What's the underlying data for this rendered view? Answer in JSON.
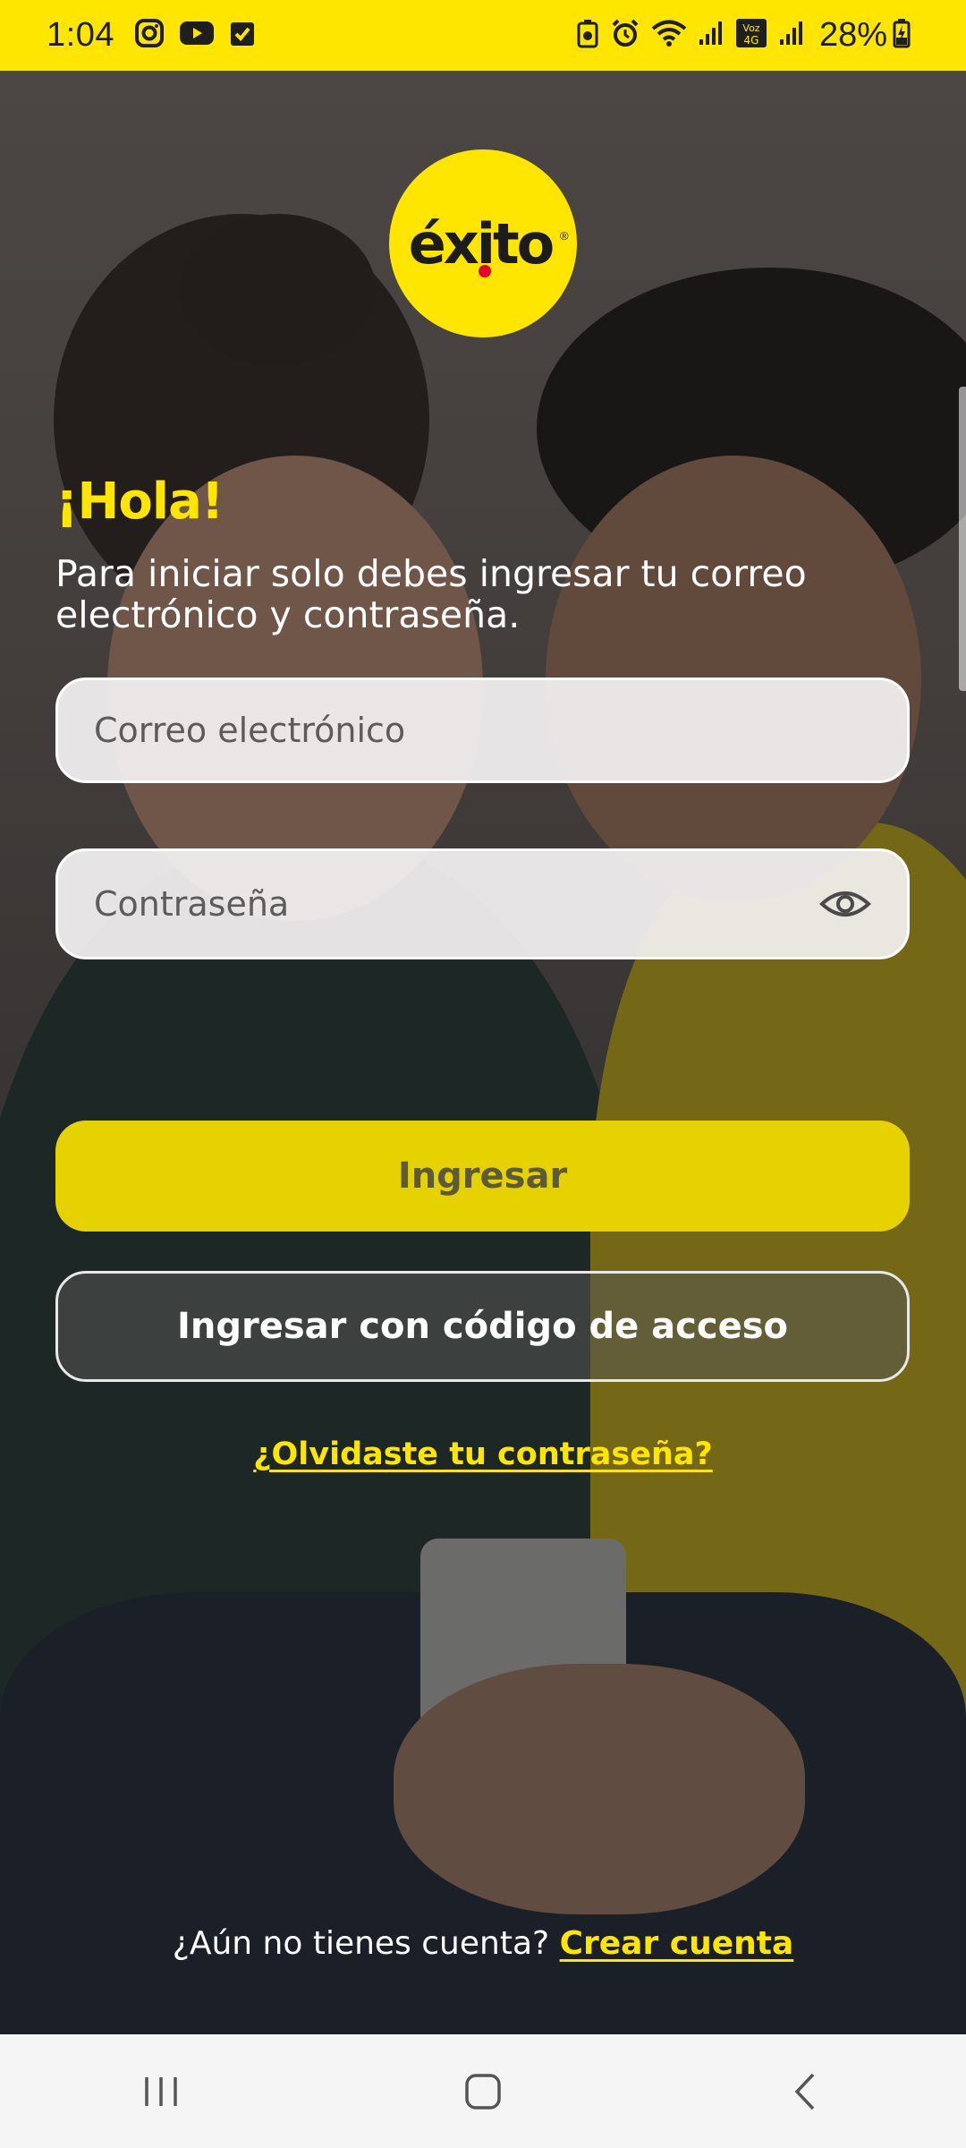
{
  "status_bar": {
    "time": "1:04",
    "battery": "28%",
    "icons_left": [
      "instagram-icon",
      "youtube-icon",
      "checkbox-icon"
    ],
    "icons_right": [
      "alarm-clock-icon",
      "wifi-icon",
      "signal-icon",
      "volte-icon",
      "signal-icon",
      "battery-charging-icon"
    ]
  },
  "brand": {
    "logo_text": "éxito",
    "accent_color": "#ffe600",
    "dot_color": "#e4002b"
  },
  "login": {
    "greeting": "¡Hola!",
    "intro": "Para iniciar solo debes ingresar tu correo electrónico y contraseña.",
    "email_placeholder": "Correo electrónico",
    "email_value": "",
    "password_placeholder": "Contraseña",
    "password_value": "",
    "submit_label": "Ingresar",
    "code_login_label": "Ingresar con código de acceso",
    "forgot_password": "¿Olvidaste tu contraseña?",
    "no_account_text": "¿Aún no tienes cuenta?",
    "create_account": "Crear cuenta"
  },
  "nav_bar": {
    "buttons": [
      "recent-apps-icon",
      "home-icon",
      "back-icon"
    ]
  }
}
